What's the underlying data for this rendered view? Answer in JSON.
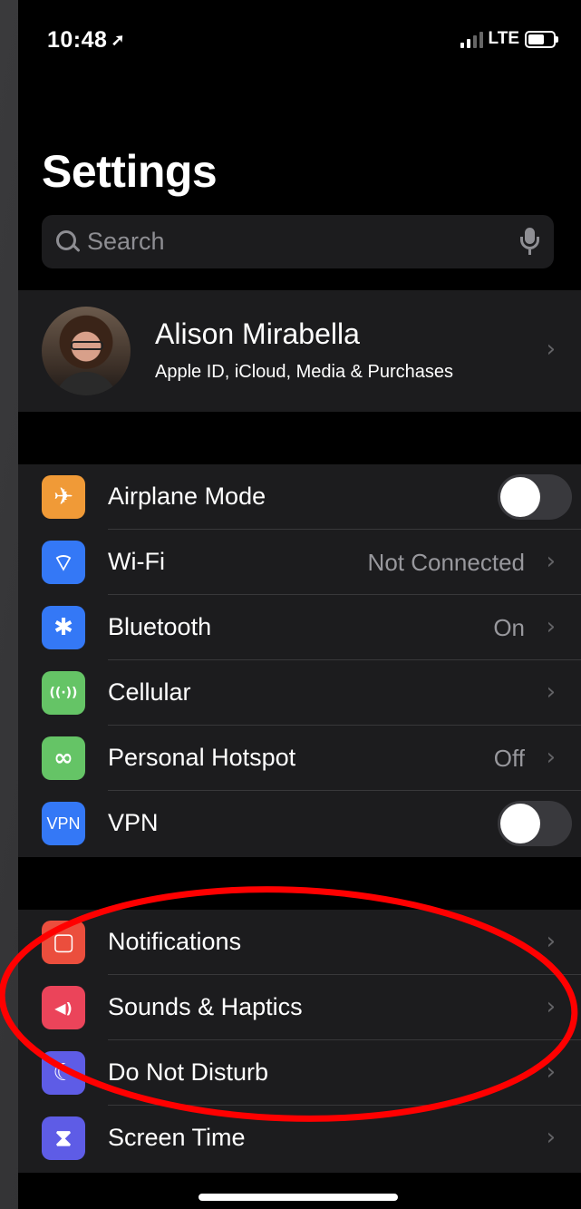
{
  "status_bar": {
    "time": "10:48",
    "carrier": "LTE",
    "battery_level": 0.7
  },
  "page": {
    "title": "Settings"
  },
  "search": {
    "placeholder": "Search"
  },
  "profile": {
    "name": "Alison Mirabella",
    "subtitle": "Apple ID, iCloud, Media & Purchases"
  },
  "group1": [
    {
      "label": "Airplane Mode",
      "icon": "airplane-icon",
      "color": "#f09a37",
      "toggle": false
    },
    {
      "label": "Wi-Fi",
      "icon": "wifi-icon",
      "color": "#3478f6",
      "value": "Not Connected"
    },
    {
      "label": "Bluetooth",
      "icon": "bluetooth-icon",
      "color": "#3478f6",
      "value": "On"
    },
    {
      "label": "Cellular",
      "icon": "cellular-icon",
      "color": "#65c466"
    },
    {
      "label": "Personal Hotspot",
      "icon": "hotspot-icon",
      "color": "#65c466",
      "value": "Off"
    },
    {
      "label": "VPN",
      "icon": "vpn-icon",
      "color": "#3478f6",
      "toggle": false,
      "icon_text": "VPN"
    }
  ],
  "group2": [
    {
      "label": "Notifications",
      "icon": "notifications-icon",
      "color": "#eb4e3d"
    },
    {
      "label": "Sounds & Haptics",
      "icon": "speaker-icon",
      "color": "#eb445a"
    },
    {
      "label": "Do Not Disturb",
      "icon": "moon-icon",
      "color": "#5e5ce6"
    },
    {
      "label": "Screen Time",
      "icon": "hourglass-icon",
      "color": "#5e5ce6"
    }
  ],
  "annotation": {
    "color": "#ff0000"
  }
}
